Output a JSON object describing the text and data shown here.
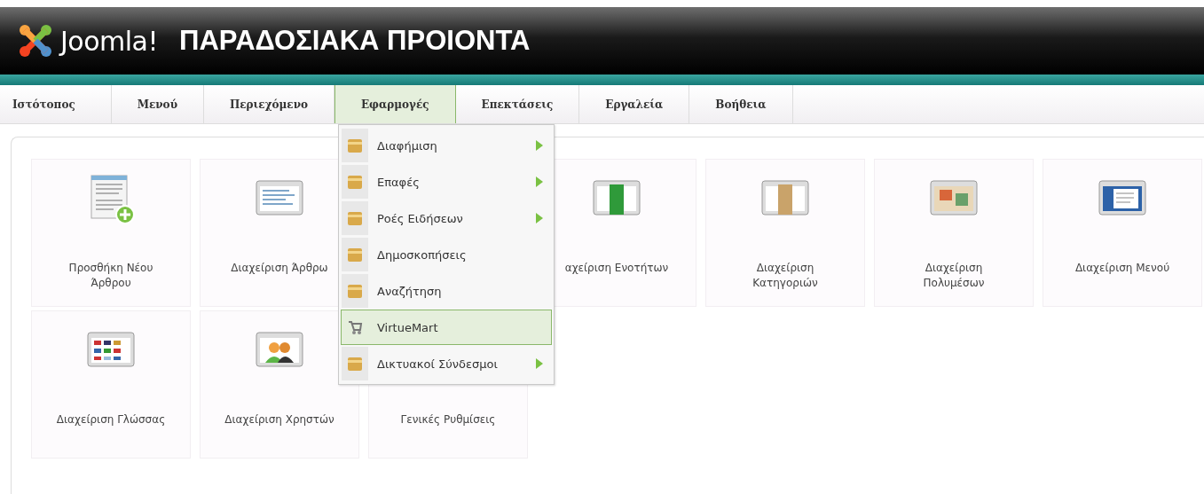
{
  "header": {
    "logo_text": "Joomla!",
    "site_title": "ΠΑΡΑΔΟΣΙΑΚΑ ΠΡΟΙΟΝΤΑ"
  },
  "menu_bar": [
    {
      "label": "Ιστότοπος",
      "selected": false
    },
    {
      "label": "Μενού",
      "selected": false
    },
    {
      "label": "Περιεχόμενο",
      "selected": false
    },
    {
      "label": "Εφαρμογές",
      "selected": true
    },
    {
      "label": "Επεκτάσεις",
      "selected": false
    },
    {
      "label": "Εργαλεία",
      "selected": false
    },
    {
      "label": "Βοήθεια",
      "selected": false
    }
  ],
  "dropdown": [
    {
      "label": "Διαφήμιση",
      "kind": "folder",
      "has_submenu": true,
      "selected": false
    },
    {
      "label": "Επαφές",
      "kind": "folder",
      "has_submenu": true,
      "selected": false
    },
    {
      "label": "Ροές Ειδήσεων",
      "kind": "folder",
      "has_submenu": true,
      "selected": false
    },
    {
      "label": "Δημοσκοπήσεις",
      "kind": "folder",
      "has_submenu": false,
      "selected": false
    },
    {
      "label": "Αναζήτηση",
      "kind": "folder",
      "has_submenu": false,
      "selected": false
    },
    {
      "label": "VirtueMart",
      "kind": "cart",
      "has_submenu": false,
      "selected": true
    },
    {
      "label": "Δικτυακοί Σύνδεσμοι",
      "kind": "folder",
      "has_submenu": true,
      "selected": false
    }
  ],
  "quick_icons": [
    {
      "label": "Προσθήκη Νέου Άρθρου",
      "kind": "add-article"
    },
    {
      "label": "Διαχείριση Άρθρω",
      "kind": "articles"
    },
    {
      "kind": "hidden"
    },
    {
      "label": "αχείριση Ενοτήτων",
      "kind": "sections"
    },
    {
      "label": "Διαχείριση Κατηγοριών",
      "kind": "categories"
    },
    {
      "label": "Διαχείριση Πολυμέσων",
      "kind": "media"
    },
    {
      "label": "Διαχείριση Μενού",
      "kind": "menus"
    },
    {
      "label": "Διαχείριση Γλώσσας",
      "kind": "language"
    },
    {
      "label": "Διαχείριση Χρηστών",
      "kind": "users"
    },
    {
      "label": "Γενικές Ρυθμίσεις",
      "kind": "config"
    }
  ]
}
